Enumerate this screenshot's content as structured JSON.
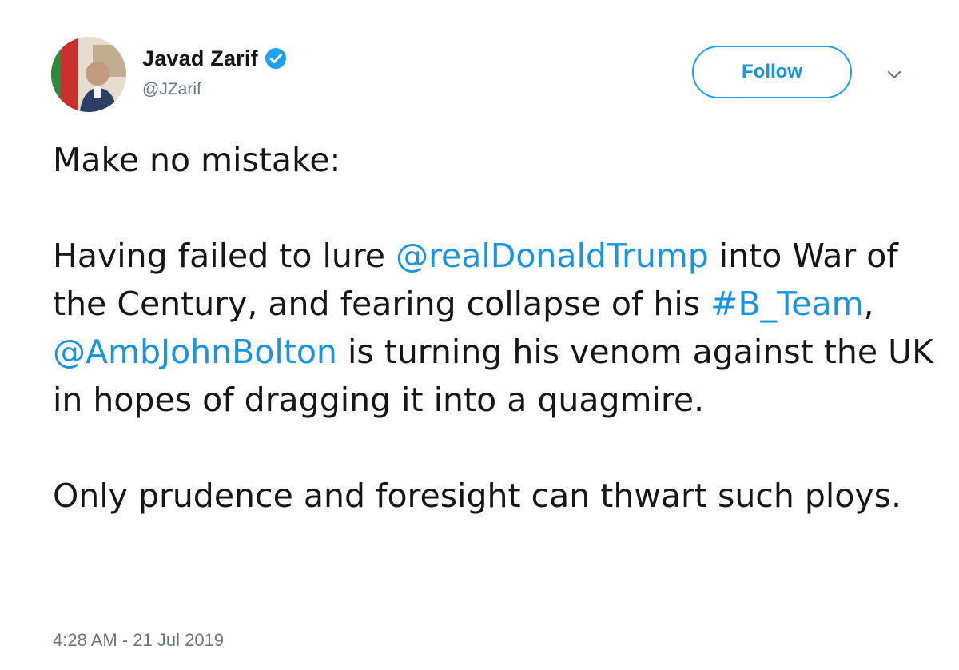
{
  "author": {
    "display_name": "Javad Zarif",
    "handle": "@JZarif",
    "verified": true
  },
  "follow_button": {
    "label": "Follow"
  },
  "icons": {
    "verified": "verified-badge-icon",
    "menu": "chevron-down-icon"
  },
  "tweet": {
    "p1": "Make no mistake:",
    "p2_part1": "Having failed to lure ",
    "p2_mention1": "@realDonaldTrump",
    "p2_part2": " into War of the Century, and fearing collapse of his ",
    "p2_hashtag": "#B_Team",
    "p2_part3": ", ",
    "p2_mention2": "@AmbJohnBolton",
    "p2_part4": " is turning his venom against the UK in hopes of dragging it into a quagmire.",
    "p3": "Only prudence and foresight can thwart such ploys."
  },
  "timestamp": "4:28 AM - 21 Jul 2019",
  "colors": {
    "link": "#1b95e0",
    "text": "#14171a",
    "muted": "#657786",
    "verified_badge": "#1da1f2"
  }
}
